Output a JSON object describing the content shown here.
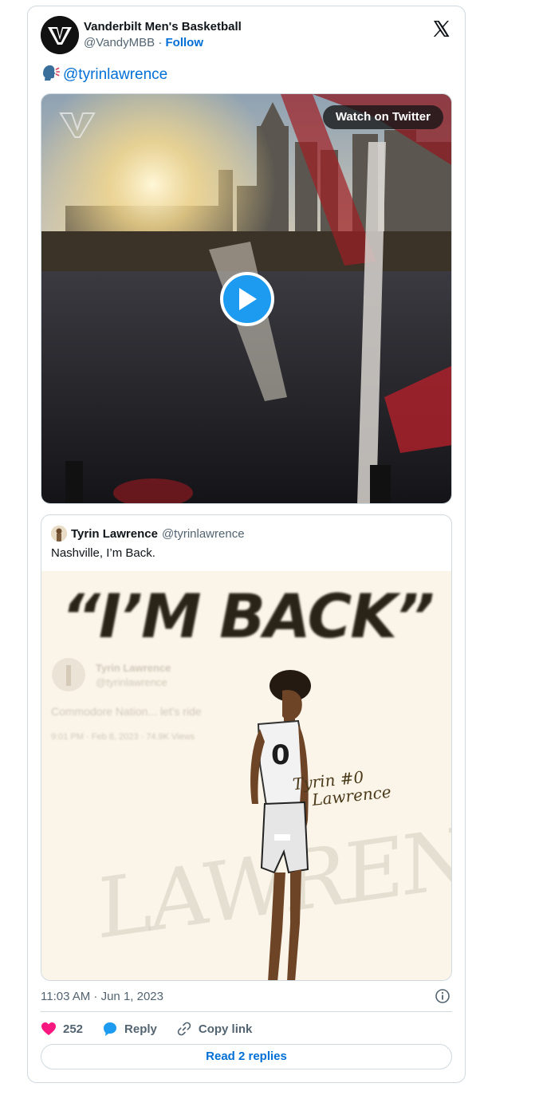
{
  "account": {
    "display_name": "Vanderbilt Men's Basketball",
    "handle": "@VandyMBB",
    "separator": " · ",
    "follow_label": "Follow"
  },
  "tweet": {
    "mention": "@tyrinlawrence",
    "speak_icon": "speaking-head-icon"
  },
  "media": {
    "watch_label": "Watch on Twitter",
    "play_icon": "play-icon"
  },
  "quoted_tweet": {
    "display_name": "Tyrin Lawrence",
    "handle": "@tyrinlawrence",
    "text": "Nashville, I’m Back.",
    "image": {
      "headline": "“I’M BACK”",
      "ghost_name": "Tyrin Lawrence",
      "ghost_handle": "@tyrinlawrence",
      "ghost_text": "Commodore Nation... let's ride",
      "ghost_meta": "9:01 PM · Feb 8, 2023 · 74.9K Views",
      "jersey_number": "0",
      "background_word": "LAWRENCE",
      "signature_line1": "Tyrin #0",
      "signature_line2": "Lawrence"
    }
  },
  "timestamp": "11:03 AM · Jun 1, 2023",
  "actions": {
    "like_count": "252",
    "reply_label": "Reply",
    "copy_label": "Copy link"
  },
  "read_replies_label": "Read 2 replies",
  "colors": {
    "link_blue": "#006fd6",
    "play_blue": "#1d9bf0",
    "like_pink": "#f91880",
    "border": "#cfd9de",
    "muted": "#536471"
  }
}
